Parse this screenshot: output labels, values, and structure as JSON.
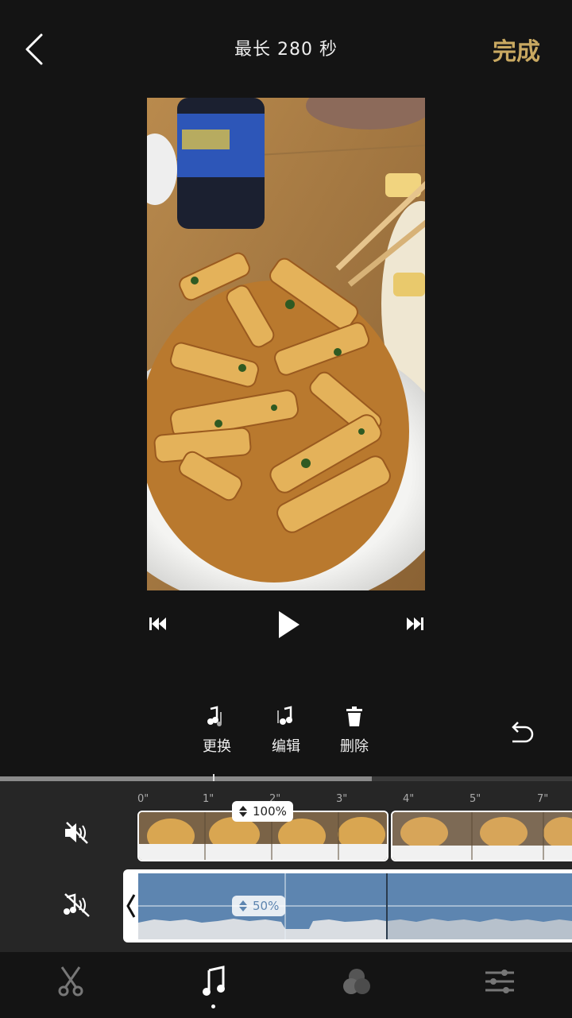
{
  "header": {
    "title": "最长 280 秒",
    "done_label": "完成"
  },
  "actions": [
    {
      "label": "更换",
      "icon": "music-replace-icon"
    },
    {
      "label": "编辑",
      "icon": "music-edit-icon"
    },
    {
      "label": "删除",
      "icon": "trash-icon"
    }
  ],
  "timeline": {
    "ticks": [
      "0\"",
      "1\"",
      "2\"",
      "3\"",
      "4\"",
      "5\"",
      "7\""
    ],
    "video_volume": "100%",
    "music_volume": "50%",
    "playback_progress": 0.65
  },
  "tabs": [
    {
      "name": "cut",
      "icon": "scissors-icon"
    },
    {
      "name": "music",
      "icon": "music-note-icon",
      "active": true
    },
    {
      "name": "filter",
      "icon": "filter-circles-icon"
    },
    {
      "name": "adjust",
      "icon": "sliders-icon"
    }
  ],
  "colors": {
    "accent": "#c9a961",
    "background": "#141414",
    "music_track": "#5d85b0"
  }
}
